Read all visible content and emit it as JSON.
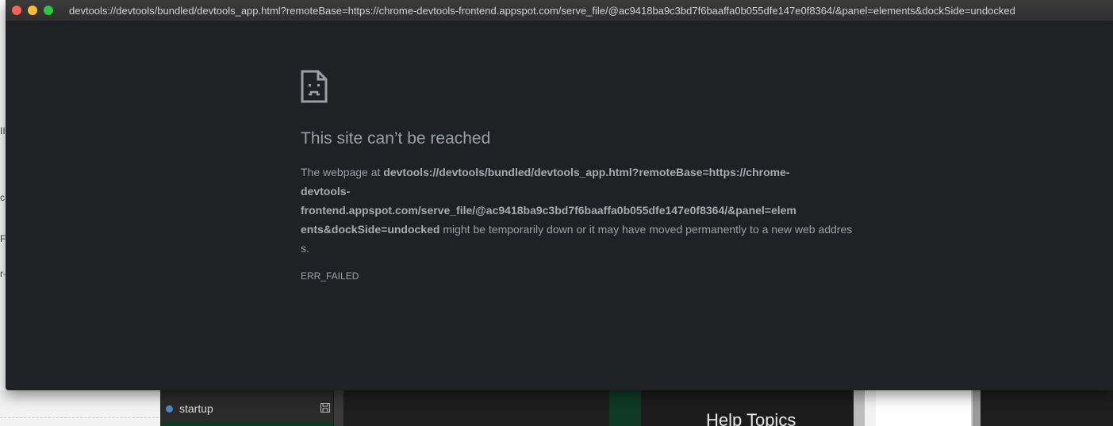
{
  "window": {
    "title": "devtools://devtools/bundled/devtools_app.html?remoteBase=https://chrome-devtools-frontend.appspot.com/serve_file/@ac9418ba9c3bd7f6baaffa0b055dfe147e0f8364/&panel=elements&dockSide=undocked"
  },
  "error": {
    "icon": "sad-page-icon",
    "heading": "This site can’t be reached",
    "body_prefix": "The webpage at ",
    "url_part1": "devtools://devtools/bundled/devtools_app.html?remoteBase=https://chrome-",
    "url_part2": "devtools-",
    "url_part3": "frontend.appspot.com/serve_file/@ac9418ba9c3bd7f6baaffa0b055dfe147e0f8364/&panel=elem",
    "url_part4": "ents&dockSide=undocked",
    "body_suffix": " might be temporarily down or it may have moved permanently to a new web address.",
    "code": "ERR_FAILED"
  },
  "background": {
    "left_fragments": [
      "II",
      "c",
      "F",
      "r-"
    ],
    "sidebar_item": "startup",
    "help_title": "Help Topics"
  },
  "colors": {
    "window_bg": "#202124",
    "text": "#9aa0a6",
    "close": "#fe5f57",
    "minimize": "#febc2e",
    "maximize": "#28c840"
  }
}
